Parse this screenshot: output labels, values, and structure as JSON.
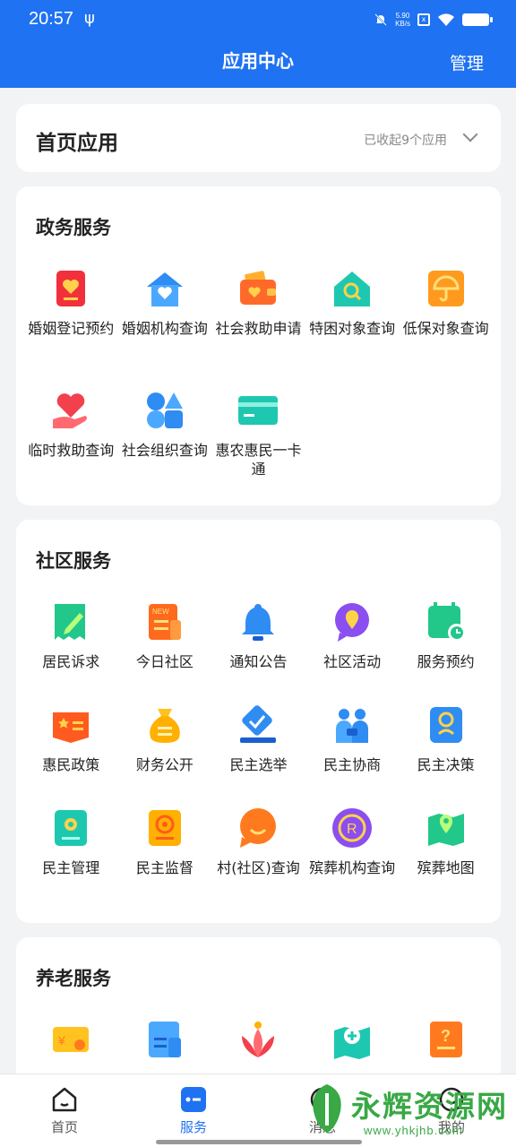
{
  "status_bar": {
    "time": "20:57",
    "usb": "ψ",
    "speed_value": "5.90",
    "speed_unit": "KB/s"
  },
  "header": {
    "title": "应用中心",
    "manage_label": "管理"
  },
  "home_apps": {
    "title": "首页应用",
    "collapsed_text": "已收起9个应用"
  },
  "gov": {
    "title": "政务服务",
    "items": [
      {
        "label": "婚姻登记预约",
        "icon": "marriage-register-icon"
      },
      {
        "label": "婚姻机构查询",
        "icon": "marriage-agency-icon"
      },
      {
        "label": "社会救助申请",
        "icon": "social-aid-wallet-icon"
      },
      {
        "label": "特困对象查询",
        "icon": "home-search-icon"
      },
      {
        "label": "低保对象查询",
        "icon": "umbrella-icon"
      },
      {
        "label": "临时救助查询",
        "icon": "hand-heart-icon"
      },
      {
        "label": "社会组织查询",
        "icon": "shapes-icon"
      },
      {
        "label": "惠农惠民一卡通",
        "icon": "bank-card-icon"
      }
    ]
  },
  "community": {
    "title": "社区服务",
    "items": [
      {
        "label": "居民诉求",
        "icon": "edit-note-icon"
      },
      {
        "label": "今日社区",
        "icon": "news-icon"
      },
      {
        "label": "通知公告",
        "icon": "bell-icon"
      },
      {
        "label": "社区活动",
        "icon": "location-chat-icon"
      },
      {
        "label": "服务预约",
        "icon": "calendar-clock-icon"
      },
      {
        "label": "惠民政策",
        "icon": "policy-card-icon"
      },
      {
        "label": "财务公开",
        "icon": "money-bag-icon"
      },
      {
        "label": "民主选举",
        "icon": "vote-check-icon"
      },
      {
        "label": "民主协商",
        "icon": "people-discuss-icon"
      },
      {
        "label": "民主决策",
        "icon": "person-badge-icon"
      },
      {
        "label": "民主管理",
        "icon": "gear-book-icon"
      },
      {
        "label": "民主监督",
        "icon": "camera-badge-icon"
      },
      {
        "label": "村(社区)查询",
        "icon": "smile-bubble-icon"
      },
      {
        "label": "殡葬机构查询",
        "icon": "registered-circle-icon"
      },
      {
        "label": "殡葬地图",
        "icon": "map-pin-icon"
      }
    ]
  },
  "elderly": {
    "title": "养老服务",
    "items": [
      {
        "label": "",
        "icon": "voucher-icon"
      },
      {
        "label": "",
        "icon": "document-icon"
      },
      {
        "label": "",
        "icon": "lotus-icon"
      },
      {
        "label": "",
        "icon": "map-medical-icon"
      },
      {
        "label": "",
        "icon": "question-doc-icon"
      }
    ]
  },
  "nav": {
    "items": [
      {
        "label": "首页",
        "icon": "home-icon"
      },
      {
        "label": "服务",
        "icon": "service-icon"
      },
      {
        "label": "消息",
        "icon": "message-icon"
      },
      {
        "label": "我的",
        "icon": "profile-icon"
      }
    ]
  },
  "watermark": {
    "text": "永辉资源网",
    "url": "www.yhkjhb.com"
  }
}
